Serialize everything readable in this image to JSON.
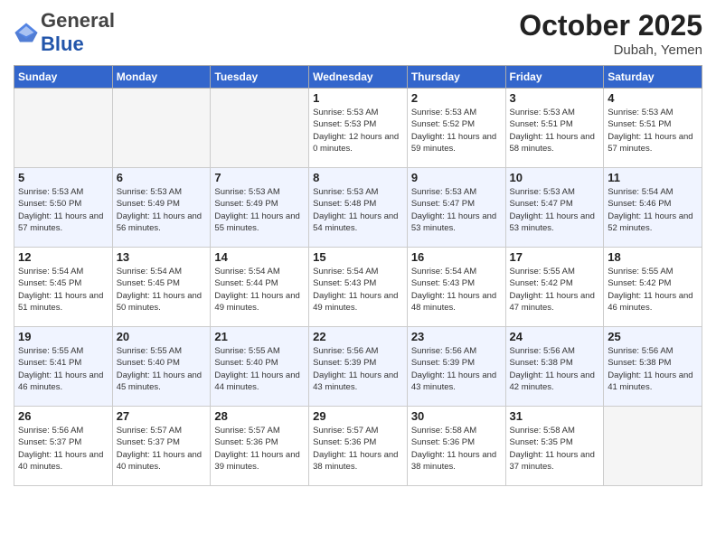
{
  "header": {
    "logo_general": "General",
    "logo_blue": "Blue",
    "month": "October 2025",
    "location": "Dubah, Yemen"
  },
  "weekdays": [
    "Sunday",
    "Monday",
    "Tuesday",
    "Wednesday",
    "Thursday",
    "Friday",
    "Saturday"
  ],
  "weeks": [
    [
      {
        "day": "",
        "sunrise": "",
        "sunset": "",
        "daylight": ""
      },
      {
        "day": "",
        "sunrise": "",
        "sunset": "",
        "daylight": ""
      },
      {
        "day": "",
        "sunrise": "",
        "sunset": "",
        "daylight": ""
      },
      {
        "day": "1",
        "sunrise": "Sunrise: 5:53 AM",
        "sunset": "Sunset: 5:53 PM",
        "daylight": "Daylight: 12 hours and 0 minutes."
      },
      {
        "day": "2",
        "sunrise": "Sunrise: 5:53 AM",
        "sunset": "Sunset: 5:52 PM",
        "daylight": "Daylight: 11 hours and 59 minutes."
      },
      {
        "day": "3",
        "sunrise": "Sunrise: 5:53 AM",
        "sunset": "Sunset: 5:51 PM",
        "daylight": "Daylight: 11 hours and 58 minutes."
      },
      {
        "day": "4",
        "sunrise": "Sunrise: 5:53 AM",
        "sunset": "Sunset: 5:51 PM",
        "daylight": "Daylight: 11 hours and 57 minutes."
      }
    ],
    [
      {
        "day": "5",
        "sunrise": "Sunrise: 5:53 AM",
        "sunset": "Sunset: 5:50 PM",
        "daylight": "Daylight: 11 hours and 57 minutes."
      },
      {
        "day": "6",
        "sunrise": "Sunrise: 5:53 AM",
        "sunset": "Sunset: 5:49 PM",
        "daylight": "Daylight: 11 hours and 56 minutes."
      },
      {
        "day": "7",
        "sunrise": "Sunrise: 5:53 AM",
        "sunset": "Sunset: 5:49 PM",
        "daylight": "Daylight: 11 hours and 55 minutes."
      },
      {
        "day": "8",
        "sunrise": "Sunrise: 5:53 AM",
        "sunset": "Sunset: 5:48 PM",
        "daylight": "Daylight: 11 hours and 54 minutes."
      },
      {
        "day": "9",
        "sunrise": "Sunrise: 5:53 AM",
        "sunset": "Sunset: 5:47 PM",
        "daylight": "Daylight: 11 hours and 53 minutes."
      },
      {
        "day": "10",
        "sunrise": "Sunrise: 5:53 AM",
        "sunset": "Sunset: 5:47 PM",
        "daylight": "Daylight: 11 hours and 53 minutes."
      },
      {
        "day": "11",
        "sunrise": "Sunrise: 5:54 AM",
        "sunset": "Sunset: 5:46 PM",
        "daylight": "Daylight: 11 hours and 52 minutes."
      }
    ],
    [
      {
        "day": "12",
        "sunrise": "Sunrise: 5:54 AM",
        "sunset": "Sunset: 5:45 PM",
        "daylight": "Daylight: 11 hours and 51 minutes."
      },
      {
        "day": "13",
        "sunrise": "Sunrise: 5:54 AM",
        "sunset": "Sunset: 5:45 PM",
        "daylight": "Daylight: 11 hours and 50 minutes."
      },
      {
        "day": "14",
        "sunrise": "Sunrise: 5:54 AM",
        "sunset": "Sunset: 5:44 PM",
        "daylight": "Daylight: 11 hours and 49 minutes."
      },
      {
        "day": "15",
        "sunrise": "Sunrise: 5:54 AM",
        "sunset": "Sunset: 5:43 PM",
        "daylight": "Daylight: 11 hours and 49 minutes."
      },
      {
        "day": "16",
        "sunrise": "Sunrise: 5:54 AM",
        "sunset": "Sunset: 5:43 PM",
        "daylight": "Daylight: 11 hours and 48 minutes."
      },
      {
        "day": "17",
        "sunrise": "Sunrise: 5:55 AM",
        "sunset": "Sunset: 5:42 PM",
        "daylight": "Daylight: 11 hours and 47 minutes."
      },
      {
        "day": "18",
        "sunrise": "Sunrise: 5:55 AM",
        "sunset": "Sunset: 5:42 PM",
        "daylight": "Daylight: 11 hours and 46 minutes."
      }
    ],
    [
      {
        "day": "19",
        "sunrise": "Sunrise: 5:55 AM",
        "sunset": "Sunset: 5:41 PM",
        "daylight": "Daylight: 11 hours and 46 minutes."
      },
      {
        "day": "20",
        "sunrise": "Sunrise: 5:55 AM",
        "sunset": "Sunset: 5:40 PM",
        "daylight": "Daylight: 11 hours and 45 minutes."
      },
      {
        "day": "21",
        "sunrise": "Sunrise: 5:55 AM",
        "sunset": "Sunset: 5:40 PM",
        "daylight": "Daylight: 11 hours and 44 minutes."
      },
      {
        "day": "22",
        "sunrise": "Sunrise: 5:56 AM",
        "sunset": "Sunset: 5:39 PM",
        "daylight": "Daylight: 11 hours and 43 minutes."
      },
      {
        "day": "23",
        "sunrise": "Sunrise: 5:56 AM",
        "sunset": "Sunset: 5:39 PM",
        "daylight": "Daylight: 11 hours and 43 minutes."
      },
      {
        "day": "24",
        "sunrise": "Sunrise: 5:56 AM",
        "sunset": "Sunset: 5:38 PM",
        "daylight": "Daylight: 11 hours and 42 minutes."
      },
      {
        "day": "25",
        "sunrise": "Sunrise: 5:56 AM",
        "sunset": "Sunset: 5:38 PM",
        "daylight": "Daylight: 11 hours and 41 minutes."
      }
    ],
    [
      {
        "day": "26",
        "sunrise": "Sunrise: 5:56 AM",
        "sunset": "Sunset: 5:37 PM",
        "daylight": "Daylight: 11 hours and 40 minutes."
      },
      {
        "day": "27",
        "sunrise": "Sunrise: 5:57 AM",
        "sunset": "Sunset: 5:37 PM",
        "daylight": "Daylight: 11 hours and 40 minutes."
      },
      {
        "day": "28",
        "sunrise": "Sunrise: 5:57 AM",
        "sunset": "Sunset: 5:36 PM",
        "daylight": "Daylight: 11 hours and 39 minutes."
      },
      {
        "day": "29",
        "sunrise": "Sunrise: 5:57 AM",
        "sunset": "Sunset: 5:36 PM",
        "daylight": "Daylight: 11 hours and 38 minutes."
      },
      {
        "day": "30",
        "sunrise": "Sunrise: 5:58 AM",
        "sunset": "Sunset: 5:36 PM",
        "daylight": "Daylight: 11 hours and 38 minutes."
      },
      {
        "day": "31",
        "sunrise": "Sunrise: 5:58 AM",
        "sunset": "Sunset: 5:35 PM",
        "daylight": "Daylight: 11 hours and 37 minutes."
      },
      {
        "day": "",
        "sunrise": "",
        "sunset": "",
        "daylight": ""
      }
    ]
  ]
}
